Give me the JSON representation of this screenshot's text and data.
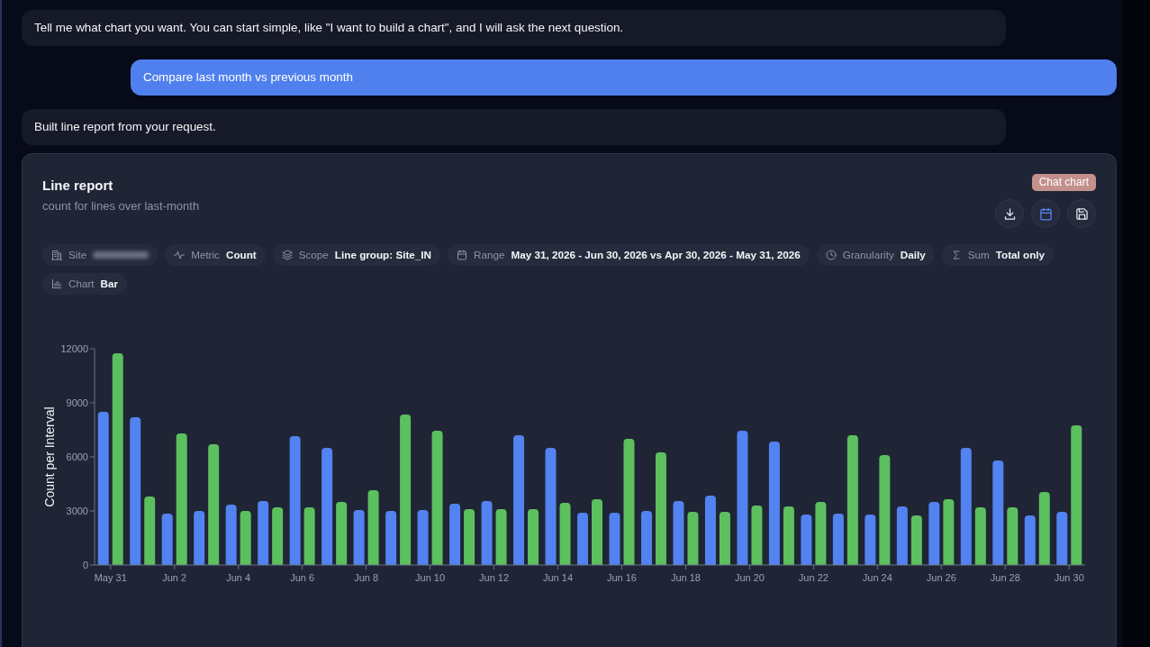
{
  "messages": [
    {
      "kind": "assistant",
      "text": "Tell me what chart you want. You can start simple, like \"I want to build a chart\", and I will ask the next question."
    },
    {
      "kind": "user",
      "text": "Compare last month vs previous month"
    },
    {
      "kind": "assistant",
      "text": "Built line report from your request."
    }
  ],
  "report": {
    "title": "Line report",
    "subtitle": "count for lines over last-month",
    "badge": "Chat chart",
    "actions": [
      {
        "active": false
      },
      {
        "active": true
      },
      {
        "active": false
      }
    ],
    "filters": [
      {
        "label": "Site",
        "redacted": true
      },
      {
        "label": "Metric",
        "value": "Count"
      },
      {
        "label": "Scope",
        "value": "Line group: Site_IN"
      },
      {
        "label": "Range",
        "value": "May 31, 2026 - Jun 30, 2026 vs Apr 30, 2026 - May 31, 2026"
      },
      {
        "label": "Granularity",
        "value": "Daily"
      },
      {
        "label": "Sum",
        "value": "Total only"
      },
      {
        "label": "Chart",
        "value": "Bar"
      }
    ],
    "chart_data": {
      "type": "bar",
      "ylabel": "Count per Interval",
      "categories": [
        "May 31",
        null,
        "Jun 2",
        null,
        "Jun 4",
        null,
        "Jun 6",
        null,
        "Jun 8",
        null,
        "Jun 10",
        null,
        "Jun 12",
        null,
        "Jun 14",
        null,
        "Jun 16",
        null,
        "Jun 18",
        null,
        "Jun 20",
        null,
        "Jun 22",
        null,
        "Jun 24",
        null,
        "Jun 26",
        null,
        "Jun 28",
        null,
        "Jun 30"
      ],
      "series": [
        {
          "color": "#5283f0",
          "values": [
            8500,
            8200,
            2850,
            3000,
            3350,
            3550,
            7150,
            6500,
            3050,
            3000,
            3050,
            3400,
            3550,
            7200,
            6500,
            2900,
            2900,
            3000,
            3550,
            3850,
            7450,
            6850,
            2800,
            2850,
            2800,
            3250,
            3500,
            6500,
            5800,
            2750,
            2950
          ]
        },
        {
          "color": "#5cc05f",
          "values": [
            11750,
            3800,
            7300,
            6700,
            3000,
            3200,
            3200,
            3500,
            4150,
            8350,
            7450,
            3100,
            3100,
            3100,
            3450,
            3650,
            7000,
            6250,
            2950,
            2950,
            3300,
            3250,
            3500,
            7200,
            6100,
            2750,
            3650,
            3200,
            3200,
            4050,
            7750
          ]
        }
      ],
      "ylim": [
        0,
        12000
      ],
      "yticks": [
        0,
        3000,
        6000,
        9000,
        12000
      ]
    }
  }
}
